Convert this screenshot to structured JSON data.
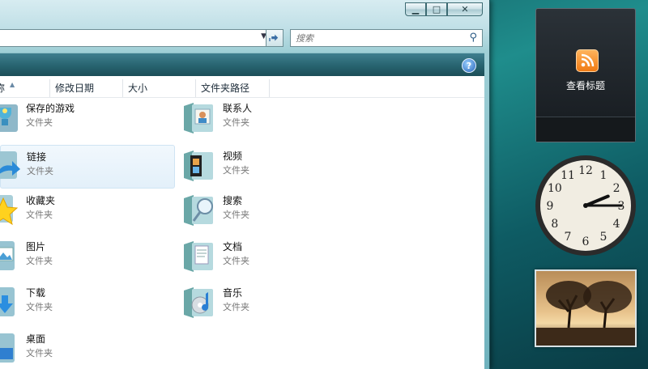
{
  "window": {
    "buttons": {
      "minimize": "▁",
      "maximize": "□",
      "close": "✕"
    },
    "search": {
      "placeholder": "搜索"
    },
    "help_label": "?"
  },
  "columns": [
    {
      "label": "名称",
      "visible_text": "称"
    },
    {
      "label": "修改日期"
    },
    {
      "label": "大小"
    },
    {
      "label": "文件夹路径"
    }
  ],
  "items": [
    {
      "name": "保存的游戏",
      "type": "文件夹",
      "icon": "saved-games-icon"
    },
    {
      "name": "链接",
      "type": "文件夹",
      "icon": "links-icon",
      "selected": true
    },
    {
      "name": "收藏夹",
      "type": "文件夹",
      "icon": "favorites-icon"
    },
    {
      "name": "图片",
      "type": "文件夹",
      "icon": "pictures-icon"
    },
    {
      "name": "下载",
      "type": "文件夹",
      "icon": "downloads-icon"
    },
    {
      "name": "桌面",
      "type": "文件夹",
      "icon": "desktop-icon"
    },
    {
      "name": "联系人",
      "type": "文件夹",
      "icon": "contacts-icon"
    },
    {
      "name": "视频",
      "type": "文件夹",
      "icon": "videos-icon"
    },
    {
      "name": "搜索",
      "type": "文件夹",
      "icon": "searches-icon"
    },
    {
      "name": "文档",
      "type": "文件夹",
      "icon": "documents-icon"
    },
    {
      "name": "音乐",
      "type": "文件夹",
      "icon": "music-icon"
    }
  ],
  "gadgets": {
    "feed": {
      "label": "查看标题",
      "icon": "rss-feed-icon"
    },
    "clock": {
      "numerals": [
        "12",
        "1",
        "2",
        "3",
        "4",
        "5",
        "6",
        "7",
        "8",
        "9",
        "10",
        "11"
      ],
      "hour": 2,
      "minute": 15
    },
    "slideshow": {
      "subject": "tree-at-sunset"
    }
  },
  "colors": {
    "accent": "#1f8d8c",
    "selection": "#e3f0fa"
  }
}
